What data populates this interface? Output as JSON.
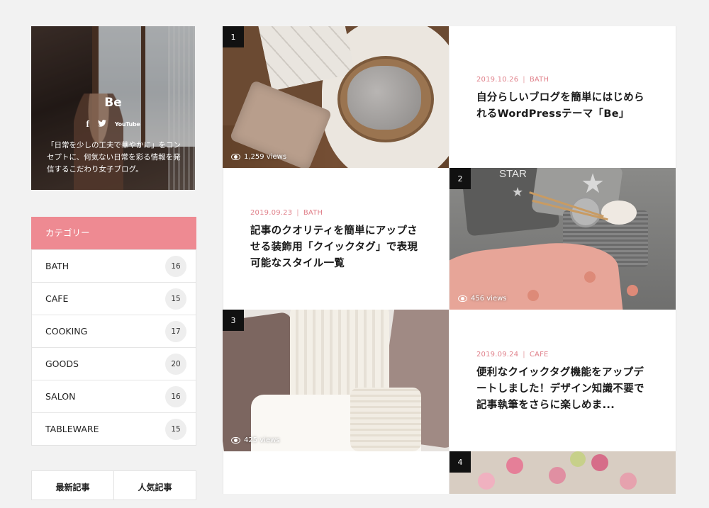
{
  "profile": {
    "name": "Be",
    "social": {
      "facebook": "f",
      "twitter": "🐦",
      "youtube": "YouTube"
    },
    "description": "「日常を少しの工夫で華やかに」をコンセプトに、何気ない日常を彩る情報を発信するこだわり女子ブログ。"
  },
  "categories": {
    "heading": "カテゴリー",
    "items": [
      {
        "label": "BATH",
        "count": "16"
      },
      {
        "label": "CAFE",
        "count": "15"
      },
      {
        "label": "COOKING",
        "count": "17"
      },
      {
        "label": "GOODS",
        "count": "20"
      },
      {
        "label": "SALON",
        "count": "16"
      },
      {
        "label": "TABLEWARE",
        "count": "15"
      }
    ]
  },
  "tabs": {
    "recent": "最新記事",
    "popular": "人気記事"
  },
  "posts": [
    {
      "rank": "1",
      "views": "1,259 views",
      "date": "2019.10.26",
      "category": "BATH",
      "title": "自分らしいブログを簡単にはじめられるWordPressテーマ「Be」"
    },
    {
      "rank": "2",
      "views": "456 views",
      "date": "2019.09.23",
      "category": "BATH",
      "title": "記事のクオリティを簡単にアップさせる装飾用「クイックタグ」で表現可能なスタイル一覧"
    },
    {
      "rank": "3",
      "views": "425 views",
      "date": "2019.09.24",
      "category": "CAFE",
      "title": "便利なクイックタグ機能をアップデートしました！デザイン知識不要で記事執筆をさらに楽しめま..."
    },
    {
      "rank": "4"
    }
  ],
  "separator": "|",
  "colors": {
    "accent": "#ee8a92",
    "meta": "#e0808a",
    "rank_badge": "#111111"
  },
  "icons": {
    "views": "eye-icon"
  }
}
